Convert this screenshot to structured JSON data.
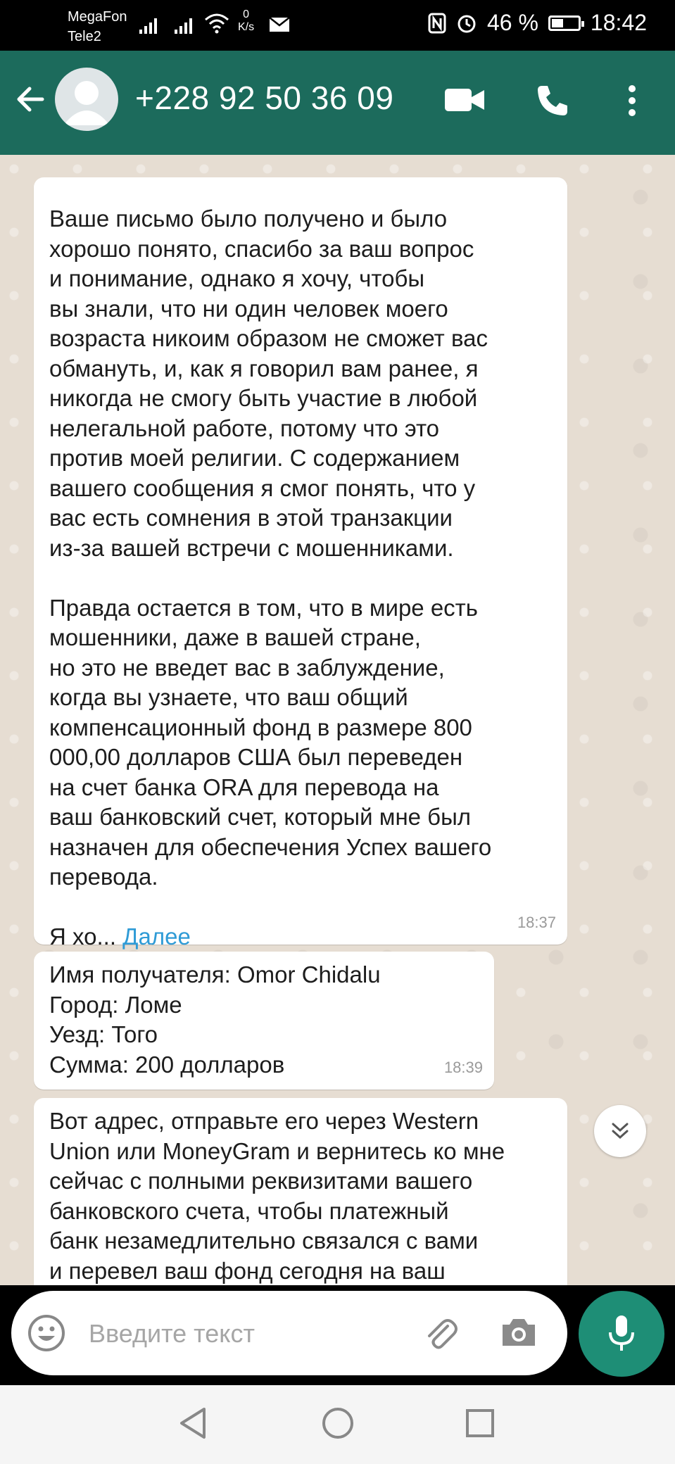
{
  "status_bar": {
    "carrier1": "MegaFon",
    "carrier2": "Tele2",
    "speed_value": "0",
    "speed_unit": "K/s",
    "battery": "46 %",
    "battery_level": 0.46,
    "time": "18:42"
  },
  "header": {
    "contact": "+228 92 50 36 09",
    "back_icon": "arrow-left-icon",
    "video_icon": "video-call-icon",
    "call_icon": "phone-icon",
    "menu_icon": "more-vertical-icon"
  },
  "messages": [
    {
      "text": "Ваше письмо было получено и было\nхорошо понято, спасибо за ваш вопрос\nи понимание, однако я хочу, чтобы\nвы знали, что ни один человек моего\nвозраста никоим образом не сможет вас\nобмануть, и, как я говорил вам ранее, я\nникогда не смогу быть участие в любой\nнелегальной работе, потому что это\nпротив моей религии. С содержанием\nвашего сообщения я смог понять, что у\nвас есть сомнения в этой транзакции\nиз-за вашей встречи с мошенниками.\n\nПравда остается в том, что в мире есть\nмошенники, даже в вашей стране,\nно это не введет вас в заблуждение,\nкогда вы узнаете, что ваш общий\nкомпенсационный фонд в размере 800\n000,00 долларов США был переведен\nна счет банка ORA для перевода на\nваш банковский счет, который мне был\nназначен для обеспечения Успех вашего\nперевода.\n\nЯ хо... ",
      "more": "Далее",
      "time": "18:37"
    },
    {
      "text": "Имя получателя: Omor Chidalu\nГород: Ломе\nУезд: Того\nСумма: 200 долларов",
      "time": "18:39"
    },
    {
      "text": "Вот адрес, отправьте его через Western\nUnion или MoneyGram и вернитесь ко мне\nсейчас с полными реквизитами вашего\nбанковского счета, чтобы платежный\nбанк незамедлительно связался с вами\nи перевел ваш фонд сегодня на ваш"
    }
  ],
  "composer": {
    "placeholder": "Введите текст"
  },
  "colors": {
    "header": "#1c6b5c",
    "chat_bg": "#e6ddd2",
    "link": "#2f9bd6",
    "mic": "#1e8e76"
  }
}
